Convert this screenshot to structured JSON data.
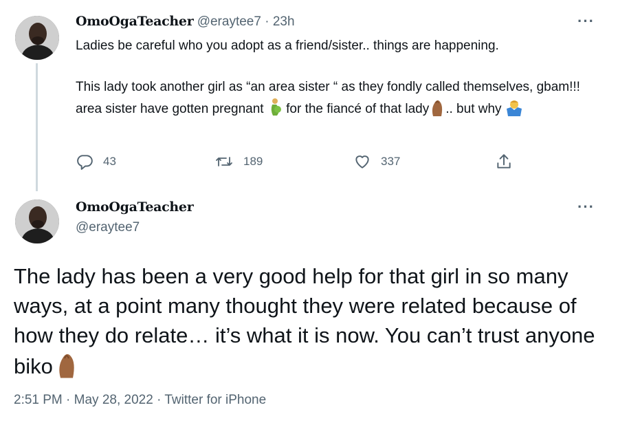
{
  "tweet1": {
    "display_name": "OmoOgaTeacher",
    "handle": "@eraytee7",
    "separator": "·",
    "age": "23h",
    "text": "Ladies be careful who you adopt as a friend/sister.. things are happening.\n\nThis lady took another girl as “an area sister “ as they fondly called themselves, gbam!!! area sister have gotten pregnant 🤰 for the fiancé of that lady🤌🏾.. but why 🤷‍♂️",
    "text_part1": "Ladies be careful who you adopt as a friend/sister.. things are happening.\n\nThis lady took another girl as “an area sister “ as they fondly called themselves, gbam!!! area sister have gotten pregnant ",
    "text_part2": " for the fiancé of that lady",
    "text_part3": ".. but why ",
    "replies": "43",
    "retweets": "189",
    "likes": "337"
  },
  "tweet2": {
    "display_name": "OmoOgaTeacher",
    "handle": "@eraytee7",
    "text": "The lady has been a very good help for that girl in so many ways, at a point many thought they were related because of how they do relate… it’s what it is now. You can’t trust anyone biko🤌🏾",
    "text_main": "The lady has been a very good help for that girl in so many ways, at a point many thought they were related because of how they do relate… it’s what it is now. You can’t trust anyone biko",
    "time": "2:51 PM",
    "date": "May 28, 2022",
    "source": "Twitter for iPhone",
    "separator": "·"
  },
  "icons": {
    "reply": "reply-icon",
    "retweet": "retweet-icon",
    "like": "heart-icon",
    "share": "share-icon",
    "more": "more-icon"
  },
  "colors": {
    "text": "#0f1419",
    "muted": "#536471",
    "thread_line": "#cfd9de",
    "emoji_skin": "#a0673f"
  }
}
